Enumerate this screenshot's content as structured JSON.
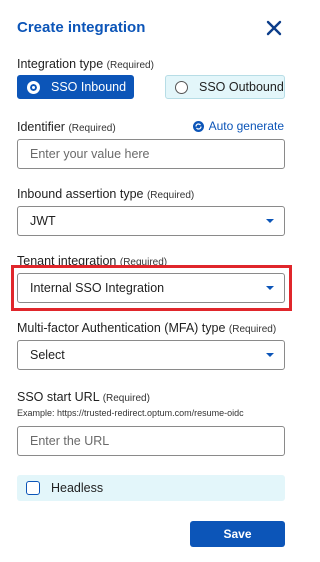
{
  "header": {
    "title": "Create integration",
    "close_icon": "close-icon"
  },
  "integration_type": {
    "label": "Integration type",
    "required": "(Required)",
    "options": [
      {
        "label": "SSO Inbound",
        "selected": true
      },
      {
        "label": "SSO Outbound",
        "selected": false
      }
    ]
  },
  "identifier": {
    "label": "Identifier",
    "required": "(Required)",
    "auto_generate": "Auto generate",
    "placeholder": "Enter your value here"
  },
  "inbound_assertion": {
    "label": "Inbound assertion type",
    "required": "(Required)",
    "value": "JWT"
  },
  "tenant_integration": {
    "label": "Tenant integration",
    "required": "(Required)",
    "value": "Internal SSO Integration"
  },
  "mfa_type": {
    "label": "Multi-factor Authentication (MFA) type",
    "required": "(Required)",
    "value": "Select"
  },
  "sso_start_url": {
    "label": "SSO start URL",
    "required": "(Required)",
    "helper": "Example: https://trusted-redirect.optum.com/resume-oidc",
    "placeholder": "Enter the URL"
  },
  "headless": {
    "label": "Headless",
    "checked": false
  },
  "footer": {
    "save_label": "Save"
  },
  "colors": {
    "primary": "#0c55b8",
    "highlight": "#e0262b",
    "tint": "#e3f6fa"
  }
}
